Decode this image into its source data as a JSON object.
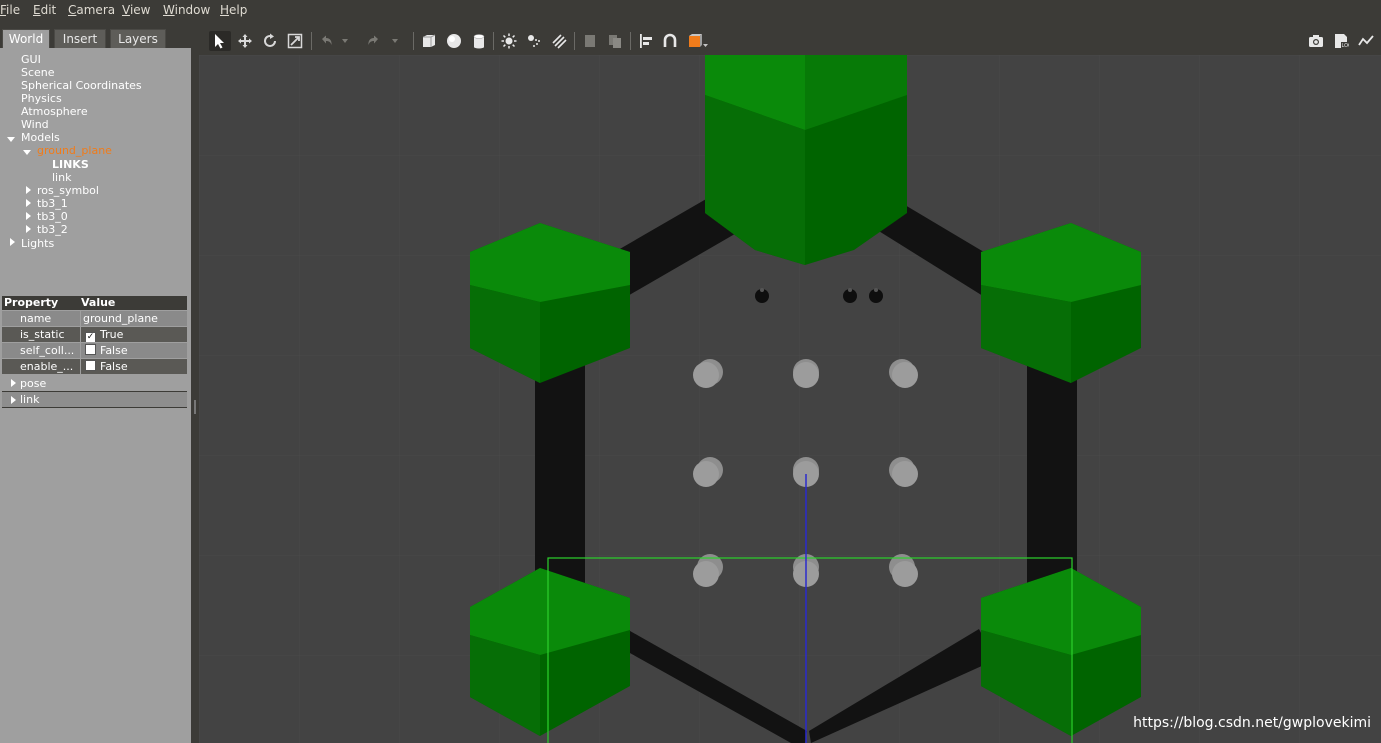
{
  "menubar": {
    "items": [
      "File",
      "Edit",
      "Camera",
      "View",
      "Window",
      "Help"
    ]
  },
  "left_panel": {
    "tabs": [
      "World",
      "Insert",
      "Layers"
    ],
    "active_tab": "World",
    "tree": {
      "world_items": [
        "GUI",
        "Scene",
        "Spherical Coordinates",
        "Physics",
        "Atmosphere",
        "Wind"
      ],
      "models_label": "Models",
      "selected_model": "ground_plane",
      "links_header": "LINKS",
      "link": "link",
      "other_models": [
        "ros_symbol",
        "tb3_1",
        "tb3_0",
        "tb3_2"
      ],
      "lights_label": "Lights"
    },
    "properties": {
      "header_property": "Property",
      "header_value": "Value",
      "rows": [
        {
          "key": "name",
          "value": "ground_plane",
          "checkbox": null
        },
        {
          "key": "is_static",
          "value": "True",
          "checkbox": true
        },
        {
          "key": "self_coll...",
          "value": "False",
          "checkbox": false
        },
        {
          "key": "enable_...",
          "value": "False",
          "checkbox": false
        }
      ],
      "groups": [
        "pose",
        "link"
      ]
    }
  },
  "toolbar": {
    "icons": [
      "select-mode-icon",
      "translate-mode-icon",
      "rotate-mode-icon",
      "scale-mode-icon",
      "undo-icon",
      "undo-history-icon",
      "redo-icon",
      "redo-history-icon",
      "box-shape-icon",
      "sphere-shape-icon",
      "cylinder-shape-icon",
      "point-light-icon",
      "spot-light-icon",
      "directional-light-icon",
      "copy-icon",
      "paste-icon",
      "align-icon",
      "snap-icon",
      "view-angle-icon",
      "screenshot-icon",
      "log-icon",
      "plot-icon"
    ],
    "active_tool": "select-mode-icon"
  },
  "scene": {
    "description_colors": {
      "background": "#434343",
      "wall": "#121212",
      "block": "#0a7a0a",
      "pillar": "#9c9c9c",
      "bbox": "#2cd12c",
      "axis": "#2b2bcc"
    }
  },
  "watermark": "https://blog.csdn.net/gwplovekimi"
}
